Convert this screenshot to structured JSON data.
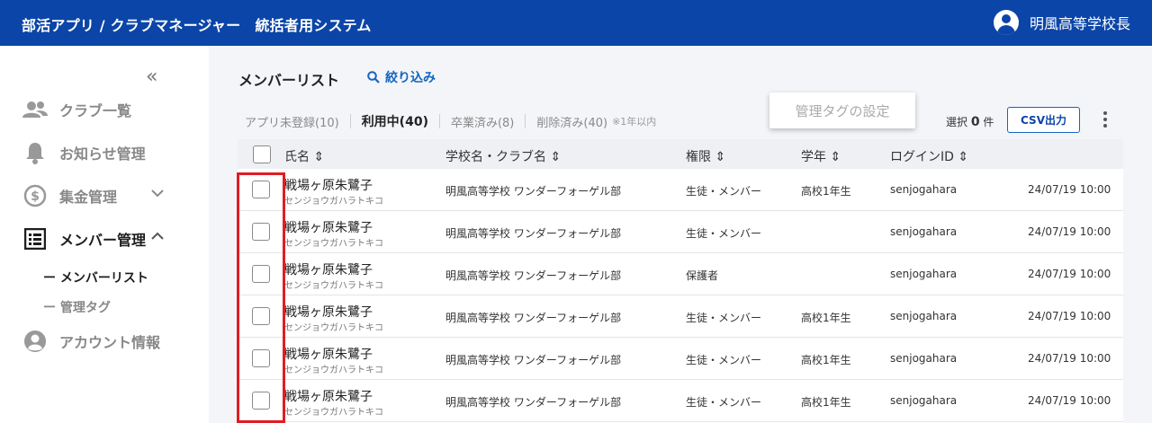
{
  "header": {
    "title": "部活アプリ / クラブマネージャー　統括者用システム",
    "user_name": "明風高等学校長"
  },
  "sidebar": {
    "items": [
      {
        "label": "クラブ一覧",
        "icon": "people-icon"
      },
      {
        "label": "お知らせ管理",
        "icon": "bell-icon"
      },
      {
        "label": "集金管理",
        "icon": "dollar-icon"
      },
      {
        "label": "メンバー管理",
        "icon": "list-icon"
      },
      {
        "label": "アカウント情報",
        "icon": "account-icon"
      }
    ],
    "sub_items": [
      {
        "label": "ー メンバーリスト"
      },
      {
        "label": "ー 管理タグ"
      }
    ]
  },
  "main": {
    "title": "メンバーリスト",
    "filter_label": "絞り込み",
    "tabs": [
      {
        "label": "アプリ未登録(10)"
      },
      {
        "label": "利用中(40)"
      },
      {
        "label": "卒業済み(8)"
      },
      {
        "label": "削除済み(40)"
      }
    ],
    "deleted_note": "※1年以内",
    "selection_prefix": "選択",
    "selection_count": "0",
    "selection_suffix": "件",
    "csv_label": "CSV出力",
    "popup_label": "管理タグの設定"
  },
  "table": {
    "headers": {
      "name": "氏名",
      "school": "学校名・クラブ名",
      "role": "権限",
      "grade": "学年",
      "login": "ログインID"
    },
    "rows": [
      {
        "name": "戦場ヶ原朱鷺子",
        "kana": "センジョウガハラトキコ",
        "school": "明風高等学校 ワンダーフォーゲル部",
        "role": "生徒・メンバー",
        "grade": "高校1年生",
        "login": "senjogahara",
        "date": "24/07/19 10:00"
      },
      {
        "name": "戦場ヶ原朱鷺子",
        "kana": "センジョウガハラトキコ",
        "school": "明風高等学校 ワンダーフォーゲル部",
        "role": "生徒・メンバー",
        "grade": "",
        "login": "senjogahara",
        "date": "24/07/19 10:00"
      },
      {
        "name": "戦場ヶ原朱鷺子",
        "kana": "センジョウガハラトキコ",
        "school": "明風高等学校 ワンダーフォーゲル部",
        "role": "保護者",
        "grade": "",
        "login": "senjogahara",
        "date": "24/07/19 10:00"
      },
      {
        "name": "戦場ヶ原朱鷺子",
        "kana": "センジョウガハラトキコ",
        "school": "明風高等学校 ワンダーフォーゲル部",
        "role": "生徒・メンバー",
        "grade": "高校1年生",
        "login": "senjogahara",
        "date": "24/07/19 10:00"
      },
      {
        "name": "戦場ヶ原朱鷺子",
        "kana": "センジョウガハラトキコ",
        "school": "明風高等学校 ワンダーフォーゲル部",
        "role": "生徒・メンバー",
        "grade": "高校1年生",
        "login": "senjogahara",
        "date": "24/07/19 10:00"
      },
      {
        "name": "戦場ヶ原朱鷺子",
        "kana": "センジョウガハラトキコ",
        "school": "明風高等学校 ワンダーフォーゲル部",
        "role": "生徒・メンバー",
        "grade": "高校1年生",
        "login": "senjogahara",
        "date": "24/07/19 10:00"
      }
    ]
  },
  "colors": {
    "header_bg": "#0b45a8",
    "accent": "#1565c0",
    "highlight": "#e21c23"
  }
}
